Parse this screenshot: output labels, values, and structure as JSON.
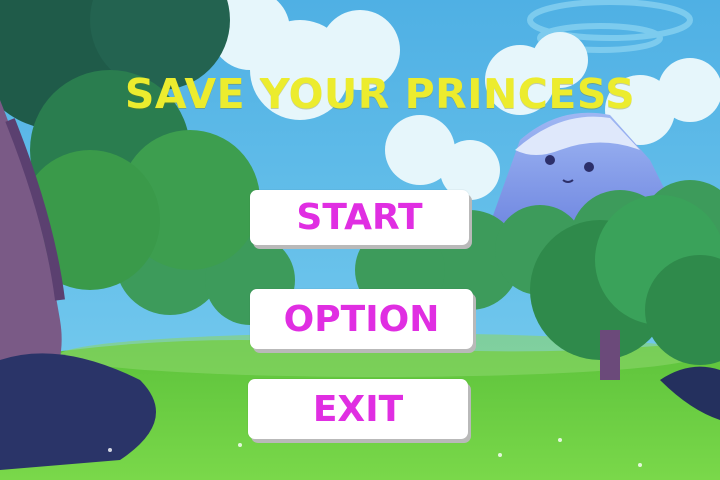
{
  "game": {
    "title": "SAVE YOUR PRINCESS",
    "menu": {
      "start_label": "START",
      "option_label": "OPTION",
      "exit_label": "EXIT"
    }
  },
  "colors": {
    "title": "#ecec2e",
    "button_text": "#e02ee2",
    "button_bg": "#ffffff",
    "sky": "#53b7e6",
    "grass": "#64c93a"
  },
  "scene": {
    "background": "forest-with-mountain-illustration",
    "mountain_face": "smiling-mountain-character"
  }
}
